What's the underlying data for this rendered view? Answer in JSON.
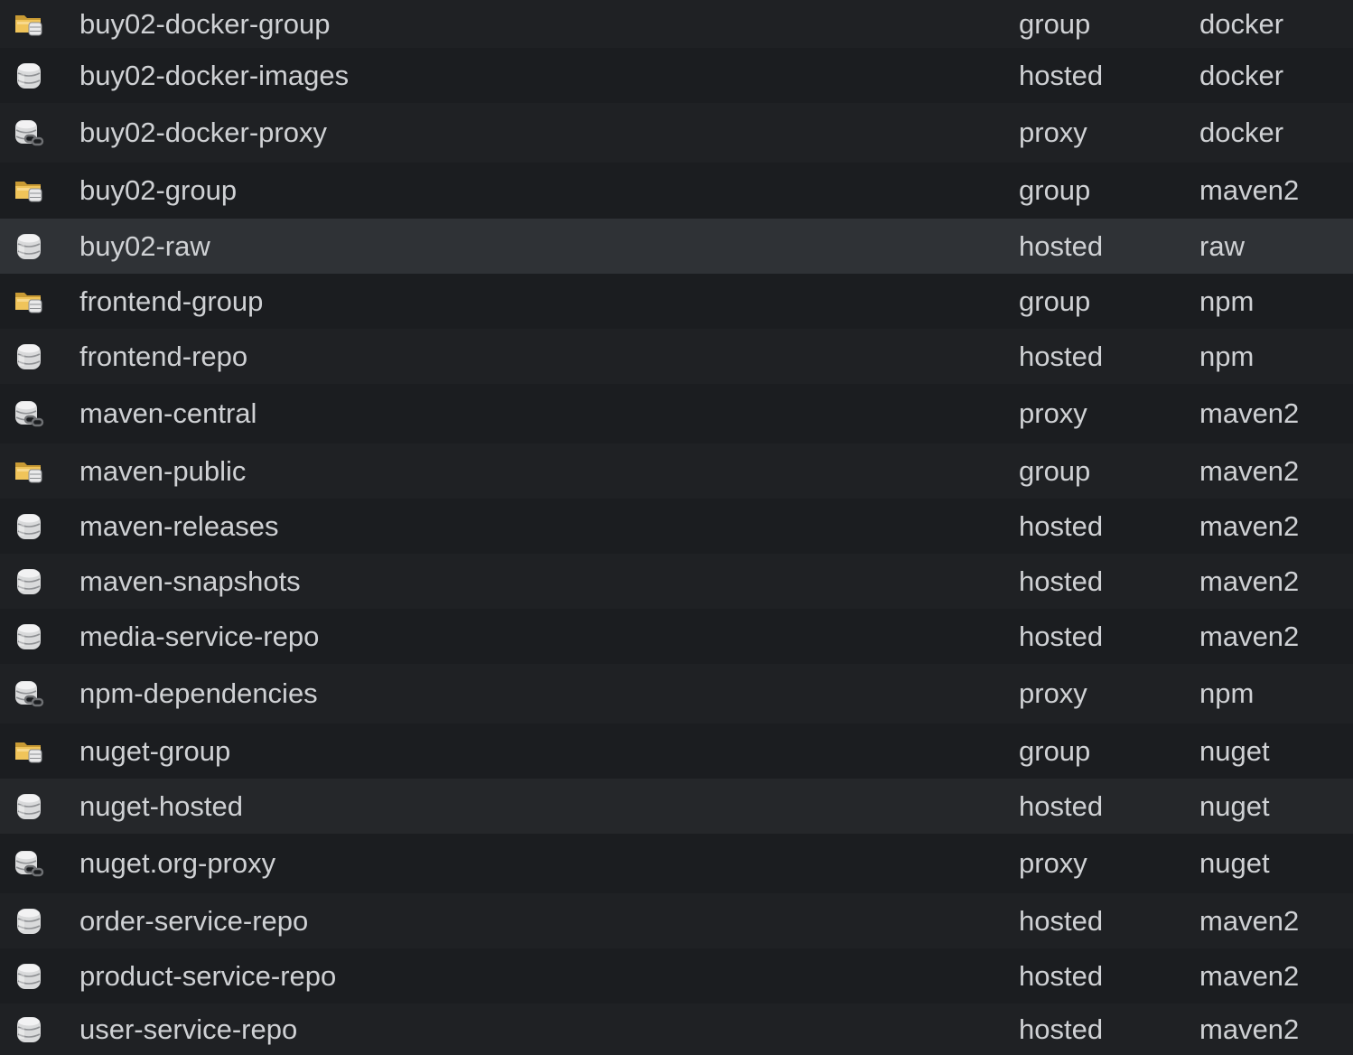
{
  "colors": {
    "row_odd": "#1f2124",
    "row_even": "#1b1d20",
    "row_hover": "#2f3236",
    "row_selected": "#25272a",
    "text": "#cfd1d4",
    "folder_icon": "#e8b84a",
    "db_icon": "#d8d8d8"
  },
  "rows": [
    {
      "icon": "group-folder-icon",
      "name": "buy02-docker-group",
      "type": "group",
      "format": "docker"
    },
    {
      "icon": "hosted-database-icon",
      "name": "buy02-docker-images",
      "type": "hosted",
      "format": "docker"
    },
    {
      "icon": "proxy-database-icon",
      "name": "buy02-docker-proxy",
      "type": "proxy",
      "format": "docker"
    },
    {
      "icon": "group-folder-icon",
      "name": "buy02-group",
      "type": "group",
      "format": "maven2"
    },
    {
      "icon": "hosted-database-icon",
      "name": "buy02-raw",
      "type": "hosted",
      "format": "raw",
      "state": "hovered"
    },
    {
      "icon": "group-folder-icon",
      "name": "frontend-group",
      "type": "group",
      "format": "npm"
    },
    {
      "icon": "hosted-database-icon",
      "name": "frontend-repo",
      "type": "hosted",
      "format": "npm"
    },
    {
      "icon": "proxy-database-icon",
      "name": "maven-central",
      "type": "proxy",
      "format": "maven2"
    },
    {
      "icon": "group-folder-icon",
      "name": "maven-public",
      "type": "group",
      "format": "maven2"
    },
    {
      "icon": "hosted-database-icon",
      "name": "maven-releases",
      "type": "hosted",
      "format": "maven2"
    },
    {
      "icon": "hosted-database-icon",
      "name": "maven-snapshots",
      "type": "hosted",
      "format": "maven2"
    },
    {
      "icon": "hosted-database-icon",
      "name": "media-service-repo",
      "type": "hosted",
      "format": "maven2"
    },
    {
      "icon": "proxy-database-icon",
      "name": "npm-dependencies",
      "type": "proxy",
      "format": "npm"
    },
    {
      "icon": "group-folder-icon",
      "name": "nuget-group",
      "type": "group",
      "format": "nuget"
    },
    {
      "icon": "hosted-database-icon",
      "name": "nuget-hosted",
      "type": "hosted",
      "format": "nuget",
      "state": "selected"
    },
    {
      "icon": "proxy-database-icon",
      "name": "nuget.org-proxy",
      "type": "proxy",
      "format": "nuget"
    },
    {
      "icon": "hosted-database-icon",
      "name": "order-service-repo",
      "type": "hosted",
      "format": "maven2"
    },
    {
      "icon": "hosted-database-icon",
      "name": "product-service-repo",
      "type": "hosted",
      "format": "maven2"
    },
    {
      "icon": "hosted-database-icon",
      "name": "user-service-repo",
      "type": "hosted",
      "format": "maven2"
    }
  ]
}
